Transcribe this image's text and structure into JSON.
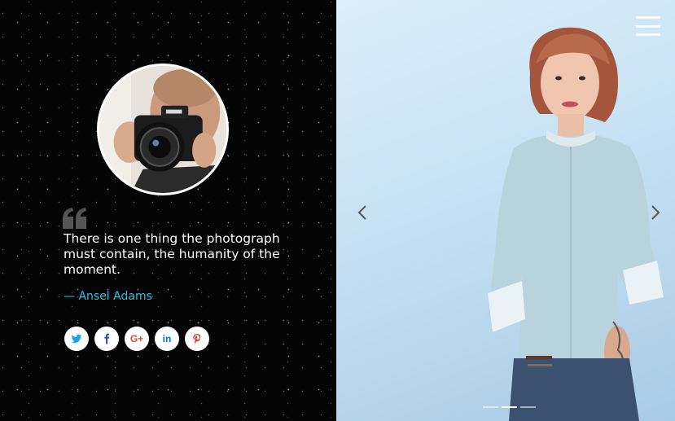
{
  "profile": {
    "avatar_icon": "photographer-avatar"
  },
  "quote": {
    "icon": "quote-icon",
    "text": "There is one thing the photograph must contain, the humanity of the moment.",
    "author": "— Ansel Adams"
  },
  "socials": [
    {
      "name": "twitter",
      "icon": "twitter-icon",
      "color": "#1da1f2"
    },
    {
      "name": "facebook",
      "icon": "facebook-icon",
      "color": "#3b5998"
    },
    {
      "name": "google-plus",
      "icon": "google-plus-icon",
      "glyph": "G+",
      "color": "#dd4b39"
    },
    {
      "name": "linkedin",
      "icon": "linkedin-icon",
      "glyph": "in",
      "color": "#0077b5"
    },
    {
      "name": "pinterest",
      "icon": "pinterest-icon",
      "color": "#cb2027"
    }
  ],
  "slider": {
    "prev_icon": "chevron-left-icon",
    "next_icon": "chevron-right-icon",
    "slide_count": 3,
    "active_slide": 2
  },
  "menu": {
    "icon": "hamburger-menu-icon"
  },
  "colors": {
    "accent": "#2bc2e3",
    "left_background": "#050505",
    "right_background": "#c6e1f3"
  }
}
